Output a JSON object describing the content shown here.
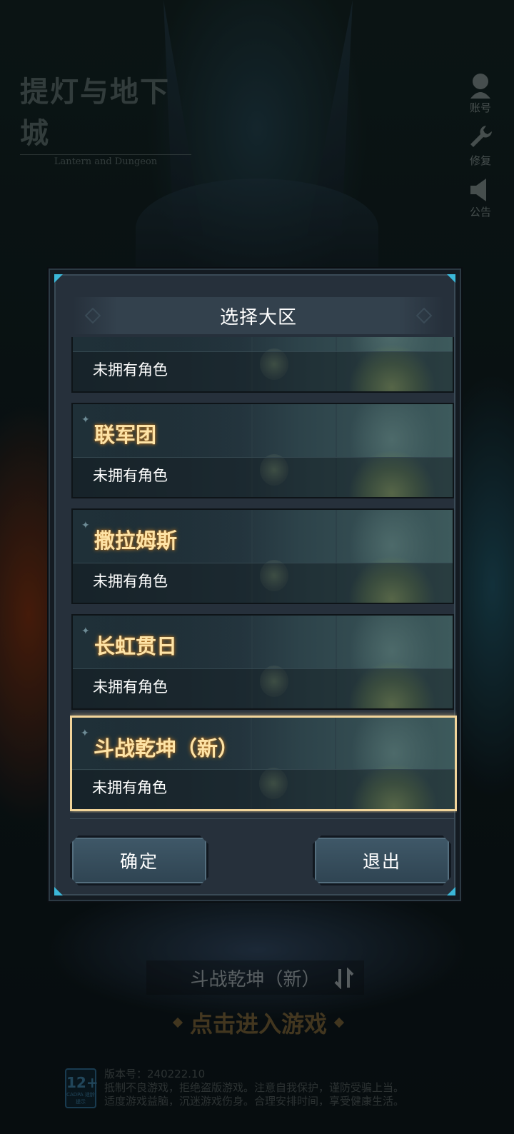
{
  "logo": {
    "title_cn": "提灯与地下城",
    "title_en": "Lantern and Dungeon"
  },
  "side_buttons": [
    {
      "label": "账号",
      "icon": "account-icon"
    },
    {
      "label": "修复",
      "icon": "wrench-icon"
    },
    {
      "label": "公告",
      "icon": "speaker-icon"
    }
  ],
  "modal": {
    "title": "选择大区",
    "servers": [
      {
        "name": "",
        "status": "未拥有角色",
        "selected": false
      },
      {
        "name": "联军团",
        "status": "未拥有角色",
        "selected": false
      },
      {
        "name": "撒拉姆斯",
        "status": "未拥有角色",
        "selected": false
      },
      {
        "name": "长虹贯日",
        "status": "未拥有角色",
        "selected": false
      },
      {
        "name": "斗战乾坤（新）",
        "status": "未拥有角色",
        "selected": true
      }
    ],
    "confirm_label": "确定",
    "exit_label": "退出"
  },
  "bottom": {
    "current_server": "斗战乾坤（新）",
    "enter_game": "点击进入游戏",
    "age_rating": "12+",
    "age_rating_sub": "CADPA 适龄提示",
    "version": "版本号：240222.10",
    "notice_line1": "抵制不良游戏，拒绝盗版游戏。注意自我保护，谨防受骗上当。",
    "notice_line2": "适度游戏益脑，沉迷游戏伤身。合理安排时间，享受健康生活。"
  },
  "colors": {
    "accent_gold": "#fde3a6",
    "selected_border": "#f1d49a",
    "panel_bg": "#26303b",
    "button_bg": "#3f5868",
    "corner_accent": "#3bb7d8"
  }
}
